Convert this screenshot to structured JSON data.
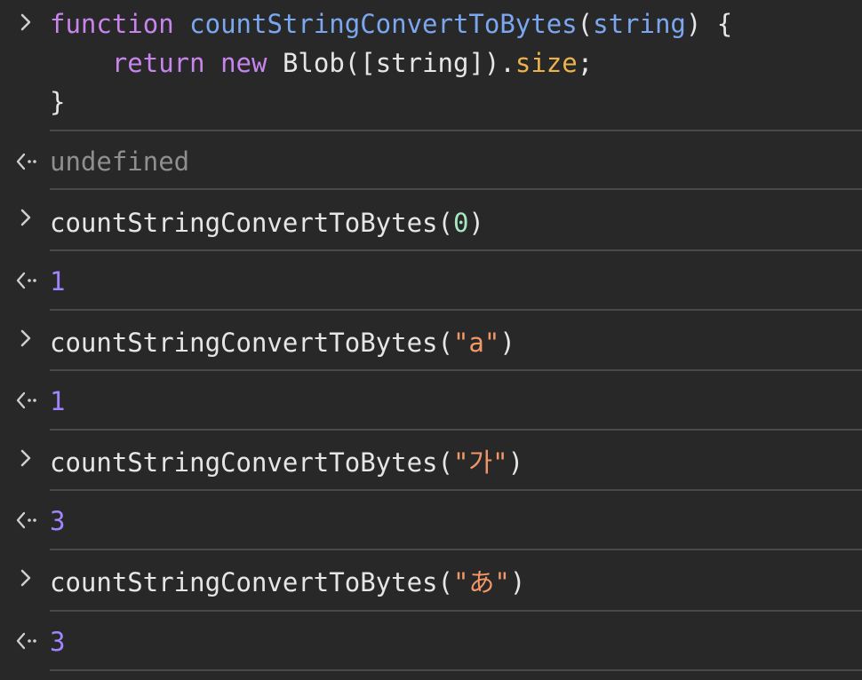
{
  "console": {
    "entries": [
      {
        "kind": "input",
        "lines": [
          {
            "kw": "function",
            "fn": "countStringConvertToBytes",
            "open": "(",
            "param": "string",
            "close": ") {"
          },
          {
            "kw_return": "return",
            "kw_new": "new",
            "cls": "Blob",
            "args": "([string])",
            "dot": ".",
            "prop": "size",
            "semi": ";"
          },
          {
            "brace": "}"
          }
        ]
      },
      {
        "kind": "output",
        "text": "undefined"
      },
      {
        "kind": "input",
        "call": "countStringConvertToBytes(",
        "arg": "0",
        "end": ")"
      },
      {
        "kind": "output",
        "text": "1"
      },
      {
        "kind": "input",
        "call": "countStringConvertToBytes(",
        "arg": "\"a\"",
        "end": ")"
      },
      {
        "kind": "output",
        "text": "1"
      },
      {
        "kind": "input",
        "call": "countStringConvertToBytes(",
        "arg": "\"가\"",
        "end": ")"
      },
      {
        "kind": "output",
        "text": "3"
      },
      {
        "kind": "input",
        "call": "countStringConvertToBytes(",
        "arg": "\"あ\"",
        "end": ")"
      },
      {
        "kind": "output",
        "text": "3"
      }
    ],
    "icons": {
      "input": "chevron-right-icon",
      "output": "return-arrow-icon"
    },
    "colors": {
      "background": "#282828",
      "keyword": "#c884ed",
      "function_name": "#7ba7f0",
      "property": "#ecb34c",
      "string": "#f29766",
      "number_input": "#a6e6c1",
      "number_result": "#9f86ff",
      "undefined": "#8f8f8f",
      "separator": "#4a4a4a"
    }
  }
}
